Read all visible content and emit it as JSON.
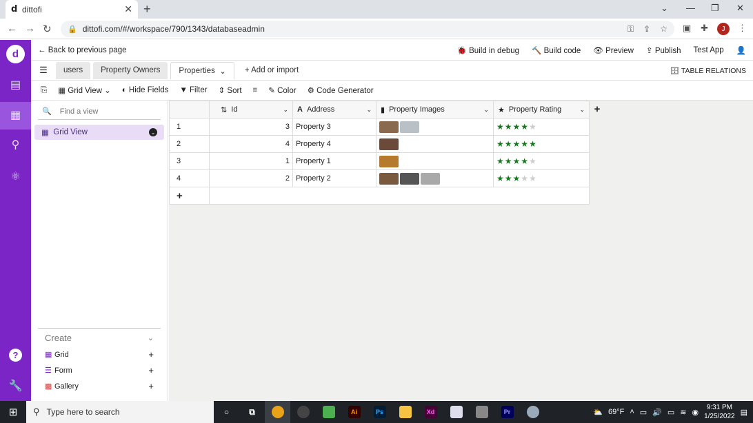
{
  "browser": {
    "tab_title": "dittofi",
    "favicon": "d",
    "url": "dittofi.com/#/workspace/790/1343/databaseadmin",
    "profile_initial": "J"
  },
  "rail": {
    "logo": "d",
    "help": "?"
  },
  "topbar": {
    "back": "Back to previous page",
    "build_debug": "Build in debug",
    "build_code": "Build code",
    "preview": "Preview",
    "publish": "Publish",
    "test_app": "Test App"
  },
  "tabs": {
    "items": [
      "users",
      "Property Owners",
      "Properties"
    ],
    "add_import": "+ Add or import",
    "relations": "TABLE RELATIONS"
  },
  "viewbar": {
    "grid_view": "Grid View",
    "hide_fields": "Hide Fields",
    "filter": "Filter",
    "sort": "Sort",
    "color": "Color",
    "code_generator": "Code Generator"
  },
  "leftpanel": {
    "search_placeholder": "Find a view",
    "current_view": "Grid View",
    "create_label": "Create",
    "create_items": [
      "Grid",
      "Form",
      "Gallery"
    ]
  },
  "grid": {
    "columns": [
      "Id",
      "Address",
      "Property Images",
      "Property Rating"
    ],
    "rows": [
      {
        "n": "1",
        "id": "3",
        "address": "Property 3",
        "images": 2,
        "rating": 4
      },
      {
        "n": "2",
        "id": "4",
        "address": "Property 4",
        "images": 1,
        "rating": 5
      },
      {
        "n": "3",
        "id": "1",
        "address": "Property 1",
        "images": 1,
        "rating": 4
      },
      {
        "n": "4",
        "id": "2",
        "address": "Property 2",
        "images": 3,
        "rating": 3
      }
    ],
    "add_row": "+",
    "add_column": "+"
  },
  "taskbar": {
    "search": "Type here to search",
    "weather": "69°F",
    "time": "9:31 PM",
    "date": "1/25/2022"
  },
  "colors": {
    "rail": "#7b25c7",
    "star": "#157a1d",
    "selected_view": "#e8dcf7"
  }
}
